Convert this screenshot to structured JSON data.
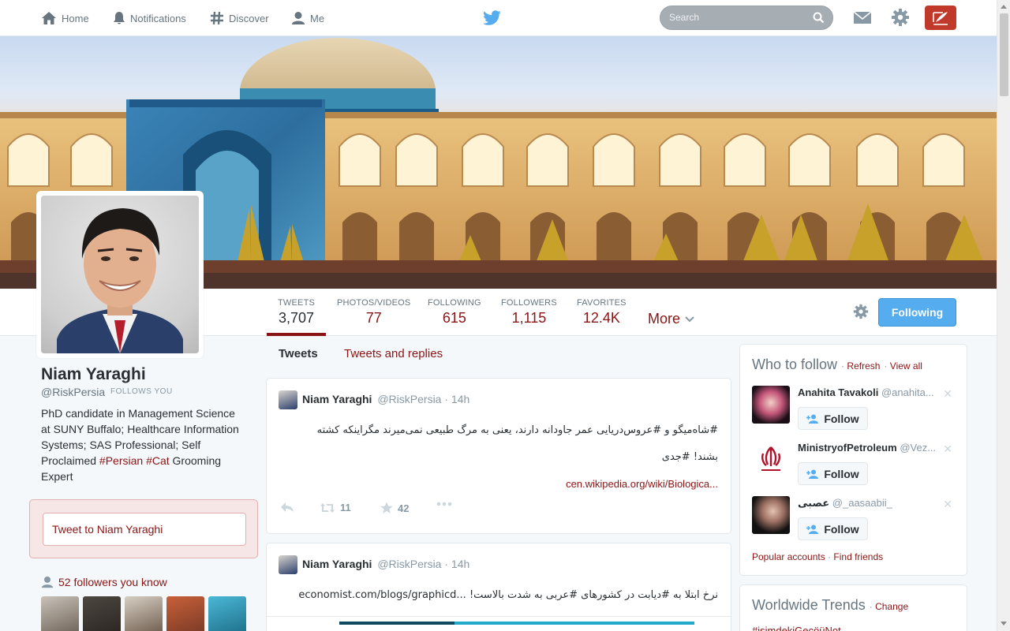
{
  "nav": {
    "home": "Home",
    "notifications": "Notifications",
    "discover": "Discover",
    "me": "Me",
    "search_placeholder": "Search"
  },
  "colors": {
    "accent": "#8a1414",
    "following_button": "#55acee",
    "compose_button": "#c0392b"
  },
  "profile": {
    "name": "Niam Yaraghi",
    "handle": "@RiskPersia",
    "follows_you": "FOLLOWS YOU",
    "bio_lines": [
      "PhD candidate in Management Science",
      "at SUNY Buffalo; Healthcare Information",
      "Systems; SAS Professional;  Self"
    ],
    "bio_line4_prefix": "Proclaimed ",
    "bio_hashtag1": "#Persian",
    "bio_hashtag2": "#Cat",
    "bio_line4_suffix": " Grooming",
    "bio_line5": "Expert",
    "tweet_to": "Tweet to Niam Yaraghi",
    "followers_you_know": "52 followers you know"
  },
  "stats": [
    {
      "label": "TWEETS",
      "value": "3,707"
    },
    {
      "label": "PHOTOS/VIDEOS",
      "value": "77"
    },
    {
      "label": "FOLLOWING",
      "value": "615"
    },
    {
      "label": "FOLLOWERS",
      "value": "1,115"
    },
    {
      "label": "FAVORITES",
      "value": "12.4K"
    }
  ],
  "more_label": "More",
  "following_label": "Following",
  "tabs": {
    "tweets": "Tweets",
    "replies": "Tweets and replies"
  },
  "tweets": [
    {
      "name": "Niam Yaraghi",
      "handle": "@RiskPersia",
      "time": "· 14h",
      "text_line1": "#شاه‌میگو  و #عروس‌دریایی  عمر جاودانه دارند، یعنی به مرگ طبیعی نمی‌میرند  مگراینکه کشته",
      "text_line2": "بشند! #جدی",
      "link": "cen.wikipedia.org/wiki/Biologica...",
      "retweets": "11",
      "favorites": "42"
    },
    {
      "name": "Niam Yaraghi",
      "handle": "@RiskPersia",
      "time": "· 14h",
      "text_line1": "نرخ ابتلا به #دیابت در کشورهای #عربی به شدت بالاست! ...economist.com/blogs/graphicd"
    }
  ],
  "who_to_follow": {
    "title": "Who to follow",
    "refresh": "Refresh",
    "view_all": "View all",
    "items": [
      {
        "name": "Anahita Tavakoli",
        "handle": "@anahita...",
        "follow": "Follow"
      },
      {
        "name": "MinistryofPetroleum",
        "handle": "@Vez...",
        "follow": "Follow"
      },
      {
        "name": "عصبی",
        "handle": "@_aasaabii_",
        "follow": "Follow"
      }
    ],
    "popular": "Popular accounts",
    "find_friends": "Find friends"
  },
  "trends": {
    "title": "Worldwide Trends",
    "change": "Change",
    "first": "#isimdekiGecöüNot"
  }
}
